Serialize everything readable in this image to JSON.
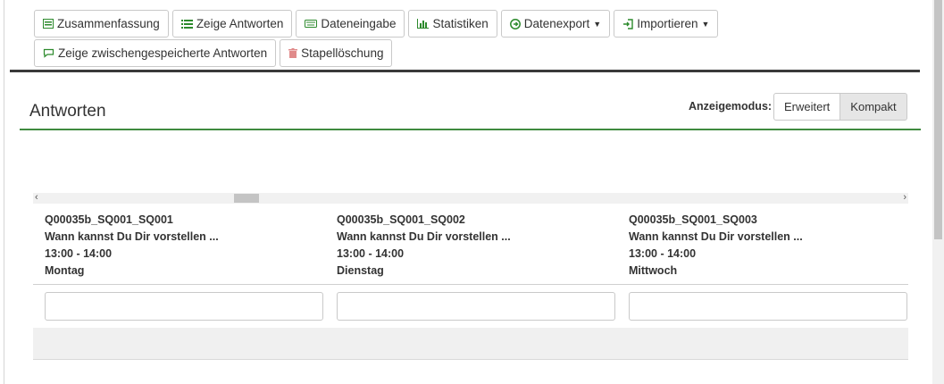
{
  "toolbar": {
    "row1": [
      {
        "label": "Zusammenfassung",
        "icon": "summary-icon"
      },
      {
        "label": "Zeige Antworten",
        "icon": "list-icon"
      },
      {
        "label": "Dateneingabe",
        "icon": "keyboard-icon"
      },
      {
        "label": "Statistiken",
        "icon": "bar-chart-icon"
      },
      {
        "label": "Datenexport",
        "icon": "export-icon",
        "dropdown": true
      },
      {
        "label": "Importieren",
        "icon": "import-icon",
        "dropdown": true
      }
    ],
    "row2": [
      {
        "label": "Zeige zwischengespeicherte Antworten",
        "icon": "comment-icon"
      },
      {
        "label": "Stapellöschung",
        "icon": "trash-icon"
      }
    ]
  },
  "page": {
    "title": "Antworten",
    "display_mode_label": "Anzeigemodus:",
    "modes": [
      "Erweitert",
      "Kompakt"
    ],
    "active_mode": "Kompakt"
  },
  "scroll": {
    "left_arrow": "‹",
    "right_arrow": "›"
  },
  "columns": [
    {
      "code": "Q00035b_SQ001_SQ001",
      "question": "Wann kannst Du Dir vorstellen ...",
      "time": "13:00 - 14:00",
      "day": "Montag",
      "filter_value": ""
    },
    {
      "code": "Q00035b_SQ001_SQ002",
      "question": "Wann kannst Du Dir vorstellen ...",
      "time": "13:00 - 14:00",
      "day": "Dienstag",
      "filter_value": ""
    },
    {
      "code": "Q00035b_SQ001_SQ003",
      "question": "Wann kannst Du Dir vorstellen ...",
      "time": "13:00 - 14:00",
      "day": "Mittwoch",
      "filter_value": ""
    }
  ],
  "colors": {
    "accent": "#3f8a3f",
    "icon_green": "#2c8a2c"
  }
}
